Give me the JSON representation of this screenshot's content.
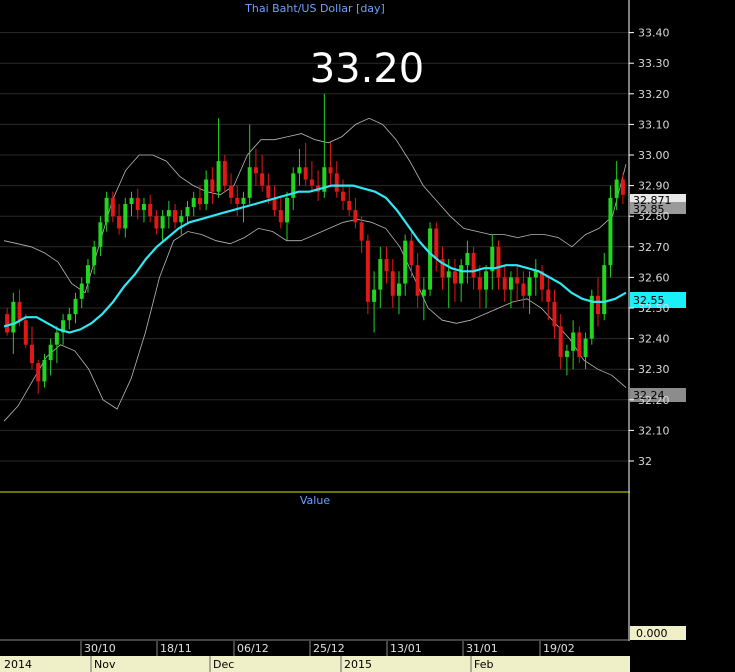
{
  "title": "Thai Baht/US Dollar [day]",
  "big_value": "33.20",
  "indicator_panel_label": "Value",
  "indicator_axis_value": "0.000",
  "price_tags": [
    {
      "label": "32.871",
      "kind": "last-close"
    },
    {
      "label": "32.85",
      "kind": "band-mid"
    },
    {
      "label": "32.55",
      "kind": "moving-average"
    },
    {
      "label": "32.24",
      "kind": "lower-band"
    }
  ],
  "colors": {
    "background": "#000000",
    "up_candle": "#21d521",
    "down_candle": "#e01818",
    "moving_average": "#2ee8f4",
    "bands": "#b8b8b8",
    "text_blue": "#6ba2ff",
    "axis_text": "#d8d8d8",
    "divider": "#e0e000",
    "timeline_bg": "#f0f0c8"
  },
  "chart_data": {
    "type": "candlestick",
    "title": "Thai Baht/US Dollar [day]",
    "y_ticks": [
      "32",
      "32.10",
      "32.20",
      "32.30",
      "32.40",
      "32.50",
      "32.60",
      "32.70",
      "32.80",
      "32.90",
      "33.00",
      "33.10",
      "33.20",
      "33.30",
      "33.40"
    ],
    "ylim": [
      31.96,
      33.47
    ],
    "x_top_labels": [
      "30/10",
      "18/11",
      "06/12",
      "25/12",
      "13/01",
      "31/01",
      "19/02"
    ],
    "x_bottom_labels": [
      "2014",
      "Nov",
      "Dec",
      "2015",
      "Feb"
    ],
    "candles": [
      [
        32.48,
        32.5,
        32.41,
        32.42
      ],
      [
        32.42,
        32.55,
        32.35,
        32.52
      ],
      [
        32.52,
        32.56,
        32.44,
        32.46
      ],
      [
        32.46,
        32.48,
        32.37,
        32.38
      ],
      [
        32.38,
        32.44,
        32.3,
        32.32
      ],
      [
        32.32,
        32.33,
        32.22,
        32.26
      ],
      [
        32.26,
        32.35,
        32.24,
        32.33
      ],
      [
        32.33,
        32.4,
        32.28,
        32.38
      ],
      [
        32.38,
        32.44,
        32.32,
        32.42
      ],
      [
        32.42,
        32.48,
        32.38,
        32.46
      ],
      [
        32.46,
        32.5,
        32.43,
        32.48
      ],
      [
        32.48,
        32.55,
        32.45,
        32.53
      ],
      [
        32.53,
        32.6,
        32.5,
        32.58
      ],
      [
        32.58,
        32.66,
        32.55,
        32.64
      ],
      [
        32.64,
        32.72,
        32.61,
        32.7
      ],
      [
        32.7,
        32.8,
        32.67,
        32.78
      ],
      [
        32.78,
        32.88,
        32.75,
        32.86
      ],
      [
        32.86,
        32.88,
        32.78,
        32.8
      ],
      [
        32.8,
        32.84,
        32.74,
        32.76
      ],
      [
        32.76,
        32.86,
        32.73,
        32.84
      ],
      [
        32.84,
        32.88,
        32.8,
        32.86
      ],
      [
        32.86,
        32.89,
        32.79,
        32.82
      ],
      [
        32.82,
        32.86,
        32.78,
        32.84
      ],
      [
        32.84,
        32.87,
        32.78,
        32.8
      ],
      [
        32.8,
        32.82,
        32.74,
        32.76
      ],
      [
        32.76,
        32.82,
        32.72,
        32.8
      ],
      [
        32.8,
        32.85,
        32.76,
        32.82
      ],
      [
        32.82,
        32.84,
        32.76,
        32.78
      ],
      [
        32.78,
        32.82,
        32.74,
        32.8
      ],
      [
        32.8,
        32.85,
        32.78,
        32.83
      ],
      [
        32.83,
        32.88,
        32.8,
        32.86
      ],
      [
        32.86,
        32.9,
        32.82,
        32.84
      ],
      [
        32.84,
        32.95,
        32.82,
        32.92
      ],
      [
        32.92,
        32.96,
        32.84,
        32.88
      ],
      [
        32.88,
        33.12,
        32.86,
        32.98
      ],
      [
        32.98,
        33.0,
        32.88,
        32.9
      ],
      [
        32.9,
        32.94,
        32.84,
        32.86
      ],
      [
        32.86,
        32.9,
        32.8,
        32.84
      ],
      [
        32.84,
        32.88,
        32.78,
        32.86
      ],
      [
        32.86,
        33.1,
        32.84,
        32.96
      ],
      [
        32.96,
        33.02,
        32.9,
        32.94
      ],
      [
        32.94,
        33.0,
        32.88,
        32.9
      ],
      [
        32.9,
        32.94,
        32.84,
        32.86
      ],
      [
        32.86,
        32.9,
        32.8,
        32.82
      ],
      [
        32.82,
        32.86,
        32.76,
        32.78
      ],
      [
        32.78,
        32.88,
        32.72,
        32.86
      ],
      [
        32.86,
        32.96,
        32.82,
        32.94
      ],
      [
        32.94,
        33.02,
        32.9,
        32.96
      ],
      [
        32.96,
        33.04,
        32.9,
        32.92
      ],
      [
        32.92,
        32.98,
        32.88,
        32.9
      ],
      [
        32.9,
        32.95,
        32.85,
        32.88
      ],
      [
        32.88,
        33.2,
        32.86,
        32.96
      ],
      [
        32.96,
        33.04,
        32.9,
        32.94
      ],
      [
        32.94,
        32.98,
        32.86,
        32.88
      ],
      [
        32.88,
        32.92,
        32.82,
        32.85
      ],
      [
        32.85,
        32.9,
        32.8,
        32.82
      ],
      [
        32.82,
        32.86,
        32.76,
        32.78
      ],
      [
        32.78,
        32.8,
        32.68,
        32.72
      ],
      [
        32.72,
        32.74,
        32.48,
        32.52
      ],
      [
        32.52,
        32.62,
        32.42,
        32.56
      ],
      [
        32.56,
        32.7,
        32.5,
        32.66
      ],
      [
        32.66,
        32.7,
        32.58,
        32.62
      ],
      [
        32.62,
        32.66,
        32.5,
        32.54
      ],
      [
        32.54,
        32.62,
        32.48,
        32.58
      ],
      [
        32.58,
        32.74,
        32.54,
        32.72
      ],
      [
        32.72,
        32.76,
        32.6,
        32.64
      ],
      [
        32.64,
        32.68,
        32.5,
        32.54
      ],
      [
        32.54,
        32.6,
        32.46,
        32.56
      ],
      [
        32.56,
        32.78,
        32.54,
        32.76
      ],
      [
        32.76,
        32.78,
        32.62,
        32.66
      ],
      [
        32.66,
        32.7,
        32.56,
        32.6
      ],
      [
        32.6,
        32.66,
        32.5,
        32.62
      ],
      [
        32.62,
        32.66,
        32.52,
        32.58
      ],
      [
        32.58,
        32.66,
        32.52,
        32.64
      ],
      [
        32.64,
        32.72,
        32.58,
        32.68
      ],
      [
        32.68,
        32.7,
        32.56,
        32.6
      ],
      [
        32.6,
        32.64,
        32.5,
        32.56
      ],
      [
        32.56,
        32.64,
        32.5,
        32.62
      ],
      [
        32.62,
        32.74,
        32.56,
        32.7
      ],
      [
        32.7,
        32.72,
        32.56,
        32.6
      ],
      [
        32.6,
        32.64,
        32.52,
        32.56
      ],
      [
        32.56,
        32.62,
        32.5,
        32.6
      ],
      [
        32.6,
        32.64,
        32.52,
        32.58
      ],
      [
        32.58,
        32.62,
        32.5,
        32.54
      ],
      [
        32.54,
        32.62,
        32.48,
        32.6
      ],
      [
        32.6,
        32.66,
        32.54,
        32.62
      ],
      [
        32.62,
        32.64,
        32.52,
        32.56
      ],
      [
        32.56,
        32.6,
        32.46,
        32.52
      ],
      [
        32.52,
        32.56,
        32.4,
        32.44
      ],
      [
        32.44,
        32.48,
        32.3,
        32.34
      ],
      [
        32.34,
        32.38,
        32.28,
        32.36
      ],
      [
        32.36,
        32.46,
        32.3,
        32.42
      ],
      [
        32.42,
        32.44,
        32.32,
        32.34
      ],
      [
        32.34,
        32.42,
        32.3,
        32.4
      ],
      [
        32.4,
        32.56,
        32.38,
        32.54
      ],
      [
        32.54,
        32.6,
        32.44,
        32.48
      ],
      [
        32.48,
        32.68,
        32.46,
        32.64
      ],
      [
        32.64,
        32.9,
        32.6,
        32.86
      ],
      [
        32.86,
        32.98,
        32.82,
        32.92
      ],
      [
        32.92,
        32.94,
        32.84,
        32.87
      ]
    ],
    "moving_average": [
      32.44,
      32.45,
      32.47,
      32.47,
      32.45,
      32.43,
      32.42,
      32.43,
      32.45,
      32.48,
      32.52,
      32.57,
      32.61,
      32.66,
      32.7,
      32.73,
      32.76,
      32.78,
      32.79,
      32.8,
      32.81,
      32.82,
      32.83,
      32.84,
      32.85,
      32.86,
      32.87,
      32.88,
      32.88,
      32.89,
      32.9,
      32.9,
      32.9,
      32.89,
      32.88,
      32.86,
      32.82,
      32.77,
      32.72,
      32.68,
      32.65,
      32.63,
      32.62,
      32.62,
      32.63,
      32.63,
      32.64,
      32.64,
      32.63,
      32.62,
      32.6,
      32.58,
      32.55,
      32.53,
      32.52,
      32.52,
      32.53,
      32.55
    ],
    "upper_band": [
      32.72,
      32.71,
      32.7,
      32.68,
      32.65,
      32.58,
      32.55,
      32.7,
      32.85,
      32.95,
      33.0,
      33.0,
      32.98,
      32.93,
      32.9,
      32.88,
      32.87,
      32.9,
      33.0,
      33.05,
      33.05,
      33.06,
      33.07,
      33.05,
      33.04,
      33.06,
      33.1,
      33.12,
      33.1,
      33.05,
      32.98,
      32.9,
      32.85,
      32.8,
      32.76,
      32.75,
      32.74,
      32.74,
      32.73,
      32.74,
      32.74,
      32.73,
      32.7,
      32.74,
      32.76,
      32.8,
      32.97
    ],
    "lower_band": [
      32.13,
      32.18,
      32.26,
      32.34,
      32.38,
      32.36,
      32.3,
      32.2,
      32.17,
      32.27,
      32.42,
      32.6,
      32.72,
      32.75,
      32.74,
      32.72,
      32.71,
      32.73,
      32.76,
      32.75,
      32.72,
      32.72,
      32.74,
      32.76,
      32.78,
      32.79,
      32.78,
      32.76,
      32.7,
      32.6,
      32.5,
      32.46,
      32.45,
      32.46,
      32.48,
      32.5,
      32.52,
      32.53,
      32.5,
      32.45,
      32.4,
      32.33,
      32.3,
      32.28,
      32.24
    ]
  }
}
